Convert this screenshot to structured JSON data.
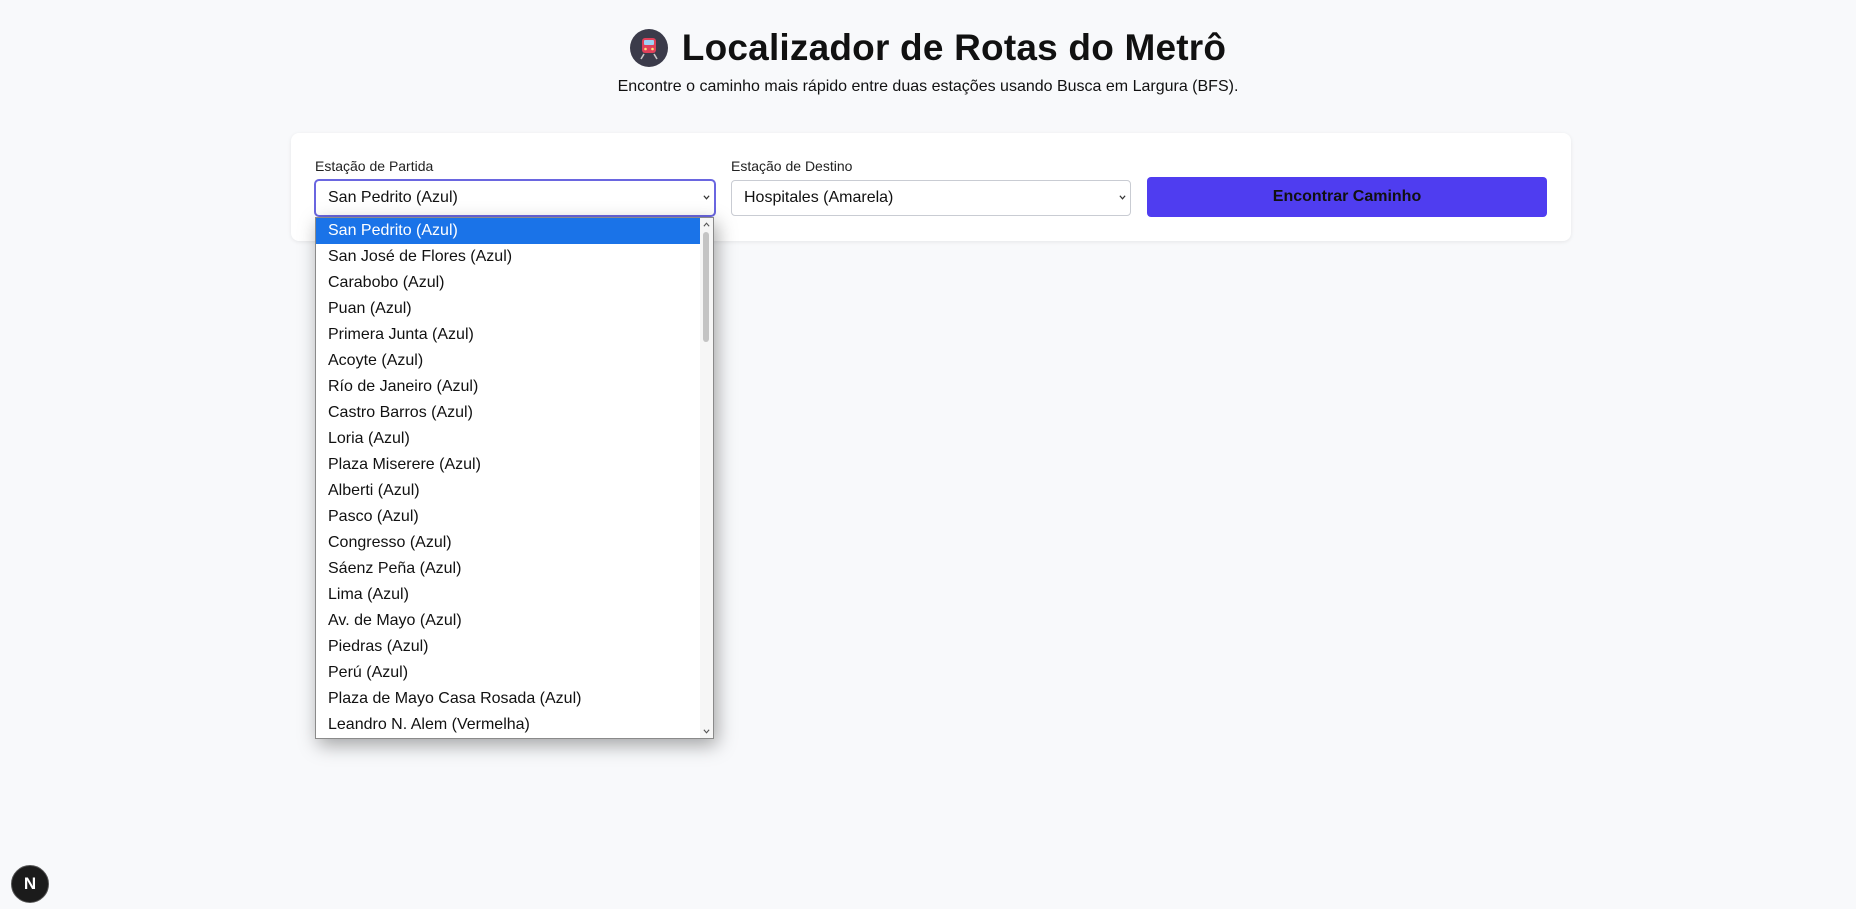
{
  "header": {
    "title": "Localizador de Rotas do Metrô",
    "title_icon": "train-icon",
    "subtitle": "Encontre o caminho mais rápido entre duas estações usando Busca em Largura (BFS)."
  },
  "form": {
    "origin_label": "Estação de Partida",
    "origin_value": "San Pedrito (Azul)",
    "destination_label": "Estação de Destino",
    "destination_value": "Hospitales (Amarela)",
    "submit_label": "Encontrar Caminho"
  },
  "dropdown": {
    "options": [
      "San Pedrito (Azul)",
      "San José de Flores (Azul)",
      "Carabobo (Azul)",
      "Puan (Azul)",
      "Primera Junta (Azul)",
      "Acoyte (Azul)",
      "Río de Janeiro (Azul)",
      "Castro Barros (Azul)",
      "Loria (Azul)",
      "Plaza Miserere (Azul)",
      "Alberti (Azul)",
      "Pasco (Azul)",
      "Congresso (Azul)",
      "Sáenz Peña (Azul)",
      "Lima (Azul)",
      "Av. de Mayo (Azul)",
      "Piedras (Azul)",
      "Perú (Azul)",
      "Plaza de Mayo Casa Rosada (Azul)",
      "Leandro N. Alem (Vermelha)"
    ],
    "selected_index": 0
  },
  "badge": {
    "label": "N",
    "icon": "nextjs-icon"
  },
  "colors": {
    "accent_button": "#4f3df0",
    "selected_option": "#1a73e8",
    "focus_border": "#6a66e0"
  }
}
